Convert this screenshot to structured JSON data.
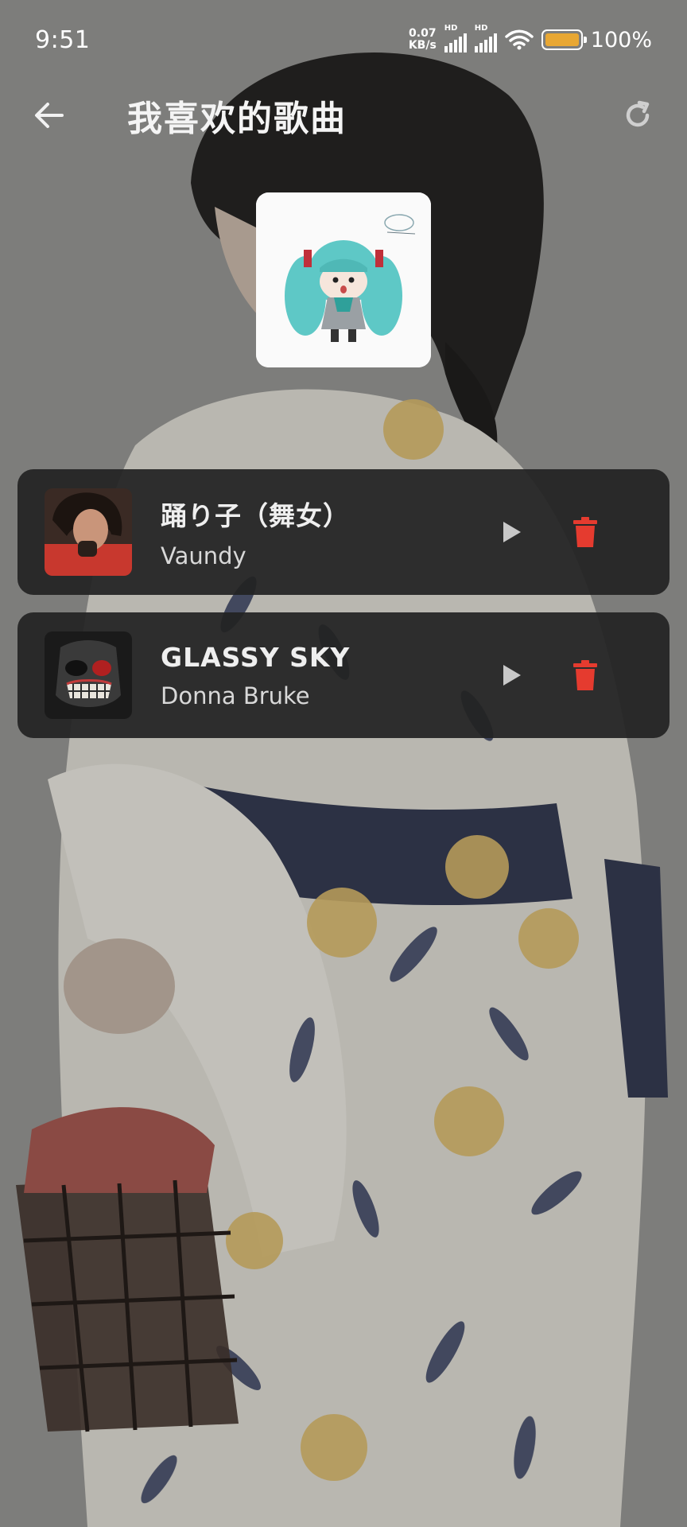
{
  "status_bar": {
    "time": "9:51",
    "net_speed_value": "0.07",
    "net_speed_unit": "KB/s",
    "sim1_label": "HD",
    "sim2_label": "HD",
    "battery_percent": "100%",
    "battery_color": "#e8a733"
  },
  "header": {
    "title": "我喜欢的歌曲",
    "back_icon": "arrow-left-icon",
    "refresh_icon": "refresh-icon"
  },
  "songs": [
    {
      "title": "踊り子（舞女）",
      "artist": "Vaundy",
      "play_icon": "play-icon",
      "delete_icon": "trash-icon"
    },
    {
      "title": "GLASSY SKY",
      "artist": "Donna Bruke",
      "play_icon": "play-icon",
      "delete_icon": "trash-icon"
    }
  ],
  "colors": {
    "delete": "#e53b2f",
    "play": "#c8c8c8",
    "card_bg": "#222222"
  }
}
